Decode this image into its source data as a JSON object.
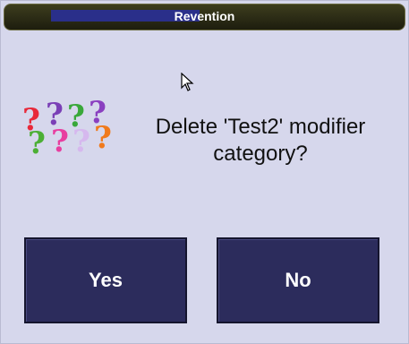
{
  "window": {
    "title": "Revention"
  },
  "dialog": {
    "icon": "question-marks-icon",
    "message": "Delete 'Test2' modifier category?"
  },
  "buttons": {
    "yes_label": "Yes",
    "no_label": "No"
  },
  "colors": {
    "background": "#d6d7ec",
    "titlebar": "#2a2a14",
    "button": "#2c2c5c",
    "button_text": "#ffffff"
  }
}
